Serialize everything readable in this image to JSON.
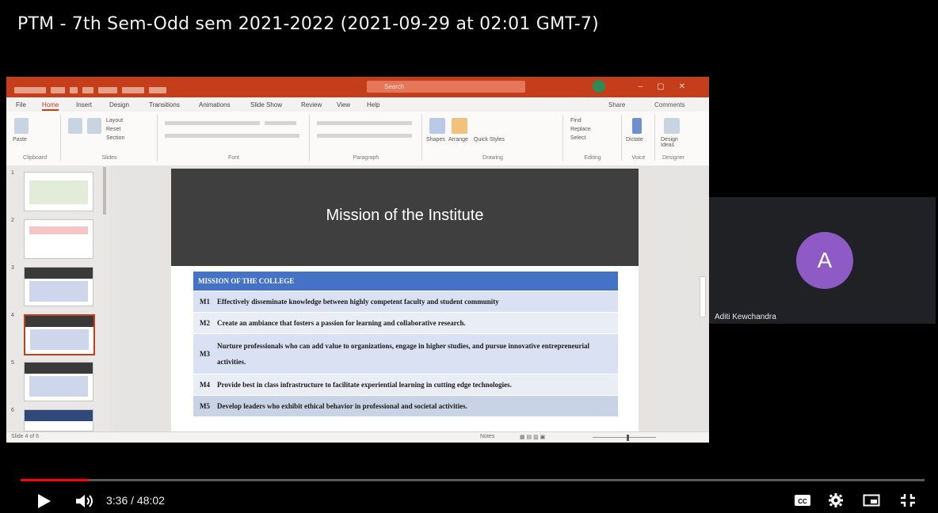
{
  "video": {
    "title": "PTM - 7th Sem-Odd sem 2021-2022 (2021-09-29 at 02:01 GMT-7)",
    "current_time": "3:36",
    "duration": "48:02",
    "time_display": "3:36 / 48:02",
    "progress_fraction": 0.075,
    "accent_color": "#ff0000"
  },
  "participant": {
    "initial": "A",
    "name": "Aditi Kewchandra",
    "avatar_color": "#8e5bc6"
  },
  "powerpoint": {
    "accent_color": "#c43e1c",
    "menu_tabs": [
      "File",
      "Home",
      "Insert",
      "Design",
      "Transitions",
      "Animations",
      "Slide Show",
      "Review",
      "View",
      "Help"
    ],
    "active_tab": "Home",
    "menu_right": [
      "Share",
      "Comments"
    ],
    "ribbon_groups": [
      "Clipboard",
      "Slides",
      "Font",
      "Paragraph",
      "Drawing",
      "Editing",
      "Voice",
      "Designer"
    ],
    "ribbon_buttons": {
      "paste": "Paste",
      "new_slide": "New Slide",
      "reuse_slides": "Reuse Slides",
      "layout": "Layout",
      "reset": "Reset",
      "section": "Section",
      "shapes": "Shapes",
      "arrange": "Arrange",
      "quick_styles": "Quick Styles",
      "find": "Find",
      "replace": "Replace",
      "select": "Select",
      "dictate": "Dictate",
      "design_ideas": "Design Ideas"
    },
    "search_placeholder": "Search",
    "thumbnail_numbers": [
      "1",
      "2",
      "3",
      "4",
      "5",
      "6"
    ],
    "selected_slide": 4,
    "status_left": "Slide 4 of 6",
    "status_notes": "Notes",
    "slide": {
      "title": "Mission of the Institute",
      "table_header": "MISSION OF THE COLLEGE",
      "rows": [
        {
          "code": "M1",
          "text": "Effectively disseminate knowledge between highly competent faculty and student community"
        },
        {
          "code": "M2",
          "text": "Create an ambiance that fosters a passion for learning and collaborative research."
        },
        {
          "code": "M3",
          "text": "Nurture professionals who can add value to organizations, engage in higher studies, and pursue innovative entrepreneurial activities."
        },
        {
          "code": "M4",
          "text": "Provide best in class infrastructure to facilitate experiential learning in cutting edge technologies."
        },
        {
          "code": "M5",
          "text": "Develop leaders who exhibit ethical behavior in professional and societal activities."
        }
      ]
    }
  },
  "player_icons": [
    "play-icon",
    "volume-icon",
    "captions-icon",
    "settings-gear-icon",
    "miniplayer-icon",
    "exit-fullscreen-icon"
  ]
}
